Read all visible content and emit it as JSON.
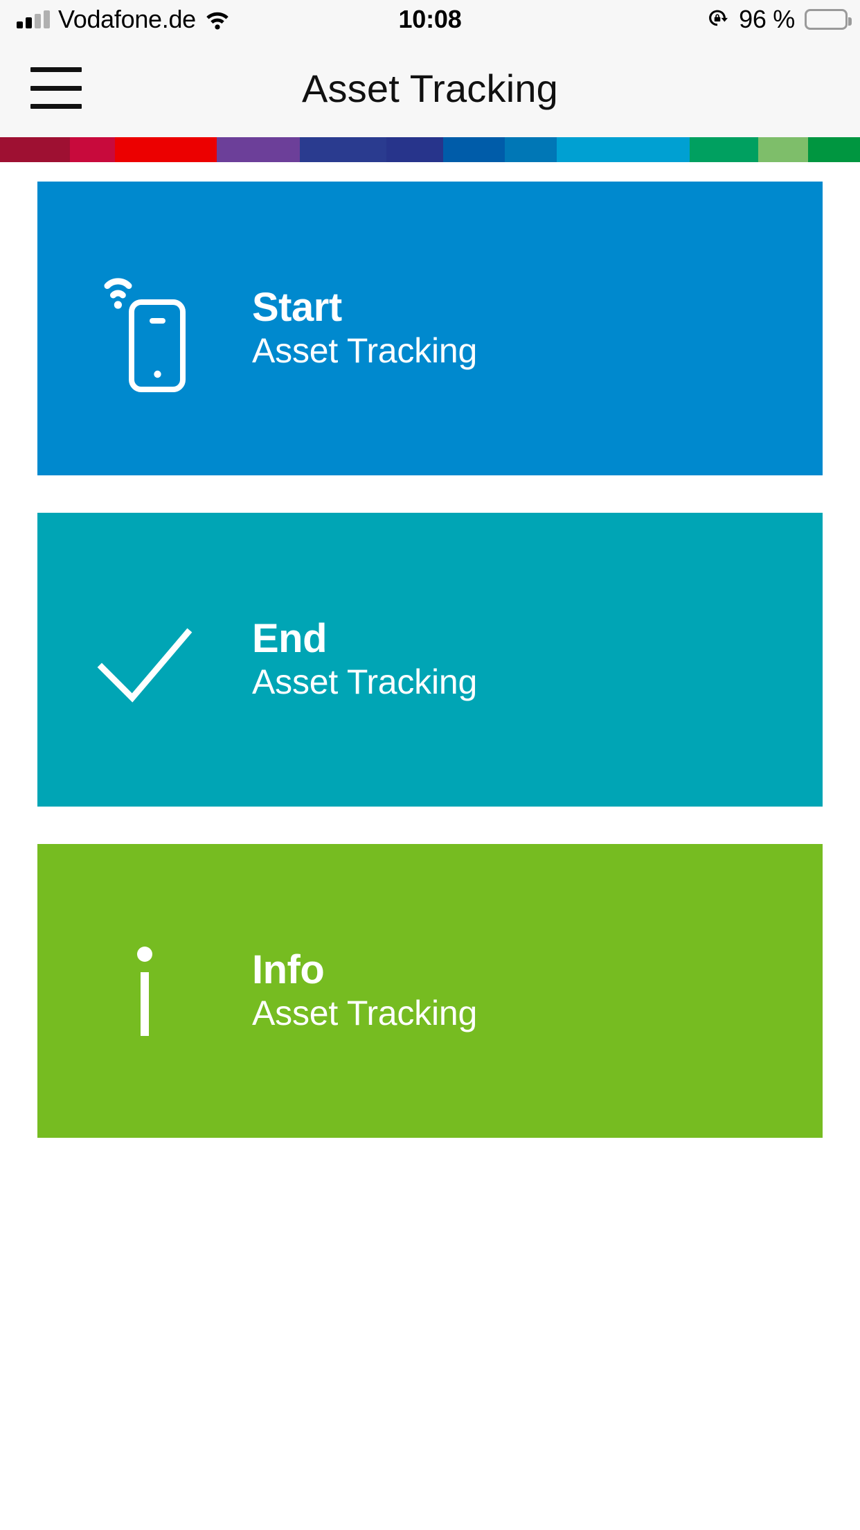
{
  "status_bar": {
    "carrier": "Vodafone.de",
    "wifi_icon": "wifi-icon",
    "signal_icon": "signal-bars-icon",
    "signal_bars_filled": 2,
    "signal_bars_total": 4,
    "time": "10:08",
    "rotation_lock_icon": "rotation-lock-icon",
    "battery_percent": "96 %",
    "battery_icon": "battery-full-icon",
    "battery_level": 100
  },
  "nav_bar": {
    "menu_icon": "hamburger-menu-icon",
    "title": "Asset Tracking"
  },
  "color_stripe": {
    "segments": [
      {
        "color": "#9e1032",
        "width": 8.1
      },
      {
        "color": "#c80a3c",
        "width": 5.3
      },
      {
        "color": "#ec0000",
        "width": 11.8
      },
      {
        "color": "#6c3f99",
        "width": 9.7
      },
      {
        "color": "#2a3b8f",
        "width": 10.0
      },
      {
        "color": "#27348b",
        "width": 6.6
      },
      {
        "color": "#005ca9",
        "width": 7.2
      },
      {
        "color": "#0077b6",
        "width": 6.0
      },
      {
        "color": "#00a0d2",
        "width": 15.5
      },
      {
        "color": "#00a060",
        "width": 8.0
      },
      {
        "color": "#7ebe6a",
        "width": 5.8
      },
      {
        "color": "#009640",
        "width": 6.0
      }
    ]
  },
  "tiles": [
    {
      "id": "start",
      "title": "Start",
      "subtitle": "Asset Tracking",
      "color": "#0089ce",
      "icon": "tag-wifi-icon"
    },
    {
      "id": "end",
      "title": "End",
      "subtitle": "Asset Tracking",
      "color": "#00a5b5",
      "icon": "checkmark-icon"
    },
    {
      "id": "info",
      "title": "Info",
      "subtitle": "Asset Tracking",
      "color": "#76bc21",
      "icon": "info-letter-icon"
    }
  ]
}
